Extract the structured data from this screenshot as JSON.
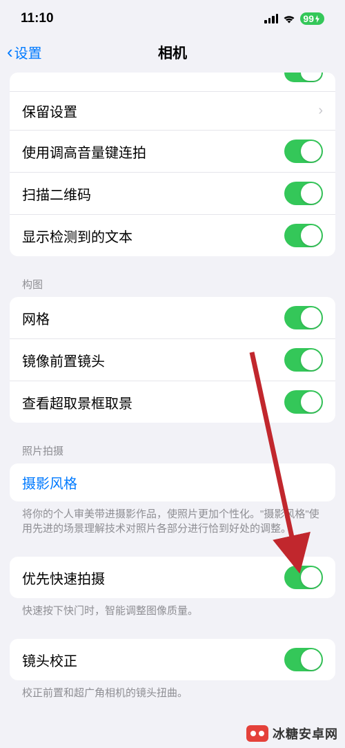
{
  "status": {
    "time": "11:10",
    "battery": "99"
  },
  "nav": {
    "back_label": "设置",
    "title": "相机"
  },
  "section1": {
    "rows": [
      {
        "label": "保留设置",
        "type": "disclosure"
      },
      {
        "label": "使用调高音量键连拍",
        "type": "toggle",
        "on": true
      },
      {
        "label": "扫描二维码",
        "type": "toggle",
        "on": true
      },
      {
        "label": "显示检测到的文本",
        "type": "toggle",
        "on": true
      }
    ]
  },
  "section2": {
    "header": "构图",
    "rows": [
      {
        "label": "网格",
        "type": "toggle",
        "on": true
      },
      {
        "label": "镜像前置镜头",
        "type": "toggle",
        "on": true
      },
      {
        "label": "查看超取景框取景",
        "type": "toggle",
        "on": true
      }
    ]
  },
  "section3": {
    "header": "照片拍摄",
    "link_label": "摄影风格",
    "footer": "将你的个人审美带进摄影作品，使照片更加个性化。\"摄影风格\"使用先进的场景理解技术对照片各部分进行恰到好处的调整。"
  },
  "section4": {
    "row_label": "优先快速拍摄",
    "footer": "快速按下快门时，智能调整图像质量。"
  },
  "section5": {
    "row_label": "镜头校正",
    "footer": "校正前置和超广角相机的镜头扭曲。"
  },
  "watermark": {
    "text": "冰糖安卓网"
  }
}
